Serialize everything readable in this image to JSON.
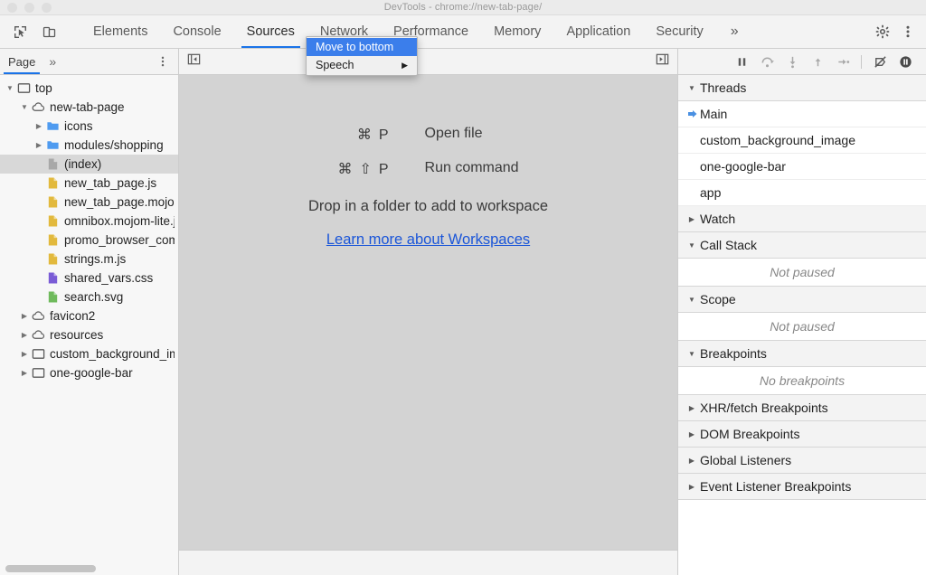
{
  "window": {
    "title": "DevTools - chrome://new-tab-page/",
    "controls": [
      "close",
      "minimize",
      "maximize"
    ]
  },
  "toolbar": {
    "inspect_icon": "inspect-cursor-icon",
    "device_icon": "device-toolbar-icon",
    "tabs": [
      {
        "label": "Elements",
        "active": false
      },
      {
        "label": "Console",
        "active": false
      },
      {
        "label": "Sources",
        "active": true
      },
      {
        "label": "Network",
        "active": false
      },
      {
        "label": "Performance",
        "active": false
      },
      {
        "label": "Memory",
        "active": false
      },
      {
        "label": "Application",
        "active": false
      },
      {
        "label": "Security",
        "active": false
      }
    ],
    "more_tabs_label": "»",
    "settings_icon": "gear-icon",
    "menu_icon": "more-vertical-icon",
    "accent_color": "#1a73e8"
  },
  "context_menu": {
    "items": [
      {
        "label": "Move to bottom",
        "highlighted": true,
        "submenu": false
      },
      {
        "label": "Speech",
        "highlighted": false,
        "submenu": true
      }
    ],
    "highlight_color": "#3b7eeb"
  },
  "navigator": {
    "tab_label": "Page",
    "more_label": "»",
    "menu_icon": "more-vertical-icon",
    "tree": [
      {
        "label": "top",
        "icon": "frame-icon",
        "depth": 0,
        "twisty": "down",
        "selected": false
      },
      {
        "label": "new-tab-page",
        "icon": "cloud-icon",
        "depth": 1,
        "twisty": "down",
        "selected": false
      },
      {
        "label": "icons",
        "icon": "folder-icon",
        "depth": 2,
        "twisty": "right",
        "selected": false
      },
      {
        "label": "modules/shopping",
        "icon": "folder-icon",
        "depth": 2,
        "twisty": "right",
        "selected": false
      },
      {
        "label": "(index)",
        "icon": "document-icon",
        "depth": 2,
        "twisty": "none",
        "selected": true
      },
      {
        "label": "new_tab_page.js",
        "icon": "js-file-icon",
        "depth": 2,
        "twisty": "none",
        "selected": false
      },
      {
        "label": "new_tab_page.mojom",
        "icon": "js-file-icon",
        "depth": 2,
        "twisty": "none",
        "selected": false
      },
      {
        "label": "omnibox.mojom-lite.js",
        "icon": "js-file-icon",
        "depth": 2,
        "twisty": "none",
        "selected": false
      },
      {
        "label": "promo_browser_command",
        "icon": "js-file-icon",
        "depth": 2,
        "twisty": "none",
        "selected": false
      },
      {
        "label": "strings.m.js",
        "icon": "js-file-icon",
        "depth": 2,
        "twisty": "none",
        "selected": false
      },
      {
        "label": "shared_vars.css",
        "icon": "css-file-icon",
        "depth": 2,
        "twisty": "none",
        "selected": false
      },
      {
        "label": "search.svg",
        "icon": "svg-file-icon",
        "depth": 2,
        "twisty": "none",
        "selected": false
      },
      {
        "label": "favicon2",
        "icon": "cloud-icon",
        "depth": 1,
        "twisty": "right",
        "selected": false
      },
      {
        "label": "resources",
        "icon": "cloud-icon",
        "depth": 1,
        "twisty": "right",
        "selected": false
      },
      {
        "label": "custom_background_image",
        "icon": "frame-icon",
        "depth": 1,
        "twisty": "right",
        "selected": false
      },
      {
        "label": "one-google-bar",
        "icon": "frame-icon",
        "depth": 1,
        "twisty": "right",
        "selected": false
      }
    ]
  },
  "editor": {
    "show_navigator_icon": "show-navigator-icon",
    "show_debugger_icon": "show-debugger-icon",
    "shortcuts": [
      {
        "keys": [
          "⌘",
          "P"
        ],
        "action": "Open file"
      },
      {
        "keys": [
          "⌘",
          "⇧",
          "P"
        ],
        "action": "Run command"
      }
    ],
    "drop_hint": "Drop in a folder to add to workspace",
    "workspaces_link": "Learn more about Workspaces",
    "link_color": "#1a55d8"
  },
  "debugger": {
    "controls": [
      {
        "name": "pause-script-execution",
        "glyph": "pause"
      },
      {
        "name": "step-over-next-function-call",
        "glyph": "step-over"
      },
      {
        "name": "step-into-next-function-call",
        "glyph": "step-into"
      },
      {
        "name": "step-out-of-current-function",
        "glyph": "step-out"
      },
      {
        "name": "step",
        "glyph": "step"
      },
      {
        "name": "deactivate-breakpoints",
        "glyph": "deactivate"
      },
      {
        "name": "pause-on-exceptions",
        "glyph": "pause-exceptions"
      }
    ],
    "sections": [
      {
        "title": "Threads",
        "expanded": true,
        "items": [
          {
            "label": "Main",
            "current": true
          },
          {
            "label": "custom_background_image",
            "current": false
          },
          {
            "label": "one-google-bar",
            "current": false
          },
          {
            "label": "app",
            "current": false
          }
        ]
      },
      {
        "title": "Watch",
        "expanded": false,
        "items": []
      },
      {
        "title": "Call Stack",
        "expanded": true,
        "empty_text": "Not paused",
        "items": []
      },
      {
        "title": "Scope",
        "expanded": true,
        "empty_text": "Not paused",
        "items": []
      },
      {
        "title": "Breakpoints",
        "expanded": true,
        "empty_text": "No breakpoints",
        "items": []
      },
      {
        "title": "XHR/fetch Breakpoints",
        "expanded": false,
        "items": []
      },
      {
        "title": "DOM Breakpoints",
        "expanded": false,
        "items": []
      },
      {
        "title": "Global Listeners",
        "expanded": false,
        "items": []
      },
      {
        "title": "Event Listener Breakpoints",
        "expanded": false,
        "items": []
      }
    ],
    "current_thread_marker_color": "#4a90e2"
  }
}
